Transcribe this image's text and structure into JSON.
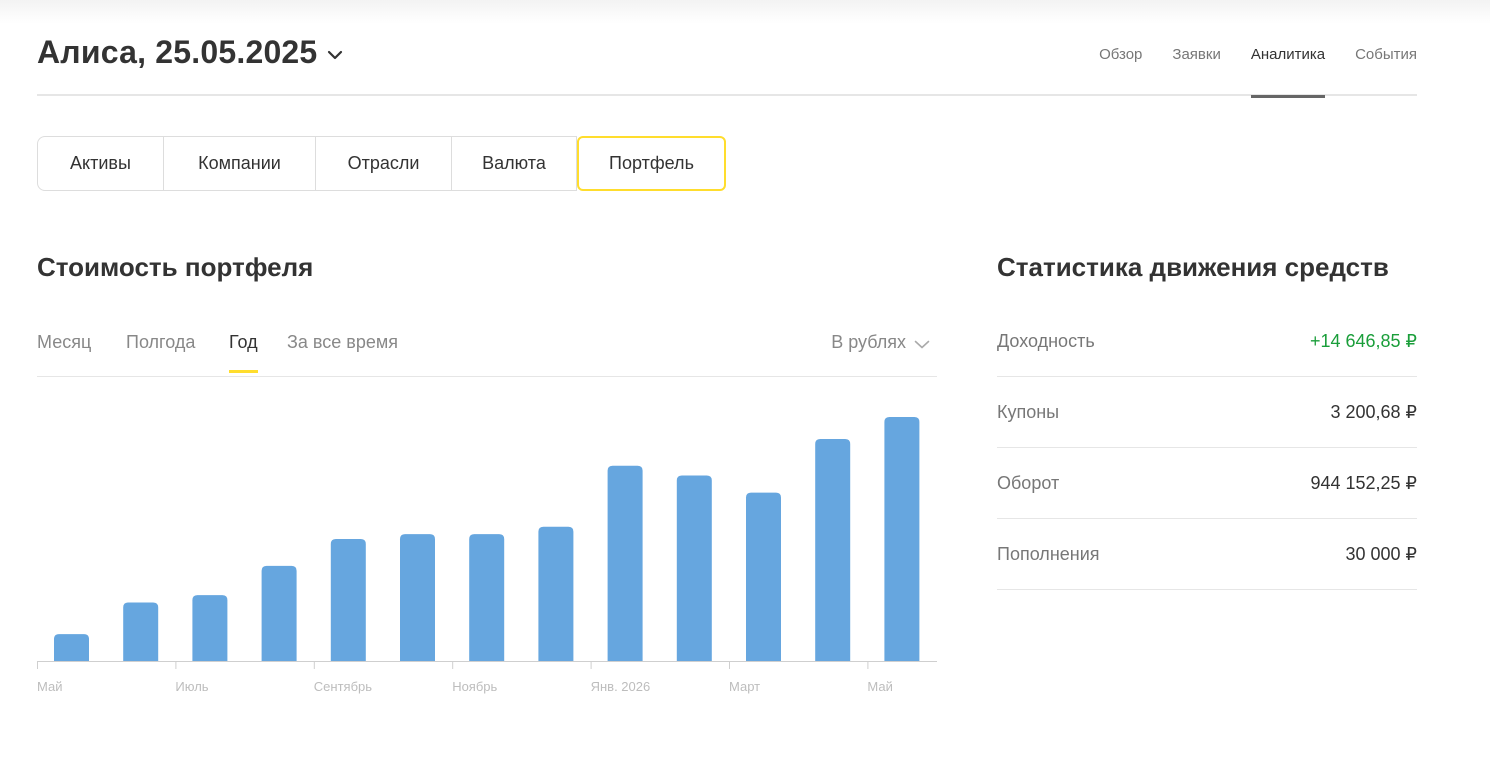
{
  "header": {
    "account_title": "Алиса, 25.05.2025",
    "nav": [
      {
        "label": "Обзор",
        "active": false
      },
      {
        "label": "Заявки",
        "active": false
      },
      {
        "label": "Аналитика",
        "active": true
      },
      {
        "label": "События",
        "active": false
      }
    ]
  },
  "segments": [
    {
      "label": "Активы",
      "active": false
    },
    {
      "label": "Компании",
      "active": false
    },
    {
      "label": "Отрасли",
      "active": false
    },
    {
      "label": "Валюта",
      "active": false
    },
    {
      "label": "Портфель",
      "active": true
    }
  ],
  "portfolio": {
    "title": "Стоимость портфеля",
    "periods": [
      {
        "label": "Месяц",
        "active": false
      },
      {
        "label": "Полгода",
        "active": false
      },
      {
        "label": "Год",
        "active": true
      },
      {
        "label": "За все время",
        "active": false
      }
    ],
    "currency_select": "В рублях"
  },
  "stats": {
    "title": "Статистика движения средств",
    "rows": [
      {
        "label": "Доходность",
        "value": "+14 646,85 ₽",
        "positive": true
      },
      {
        "label": "Купоны",
        "value": "3 200,68 ₽",
        "positive": false
      },
      {
        "label": "Оборот",
        "value": "944 152,25 ₽",
        "positive": false
      },
      {
        "label": "Пополнения",
        "value": "30 000 ₽",
        "positive": false
      }
    ]
  },
  "colors": {
    "accent": "#ffdd2d",
    "bar": "#66a6df",
    "positive": "#1a9e3a"
  },
  "chart_data": {
    "type": "bar",
    "title": "",
    "xlabel": "",
    "ylabel": "",
    "ylim": [
      0,
      100
    ],
    "grid": false,
    "values": [
      11,
      24,
      27,
      39,
      50,
      52,
      52,
      55,
      80,
      76,
      69,
      91,
      100
    ],
    "tick_labels": [
      "Май",
      "Июль",
      "Сентябрь",
      "Ноябрь",
      "Янв. 2026",
      "Март",
      "Май"
    ],
    "tick_bar_index": [
      0,
      2,
      4,
      6,
      8,
      10,
      12
    ]
  }
}
